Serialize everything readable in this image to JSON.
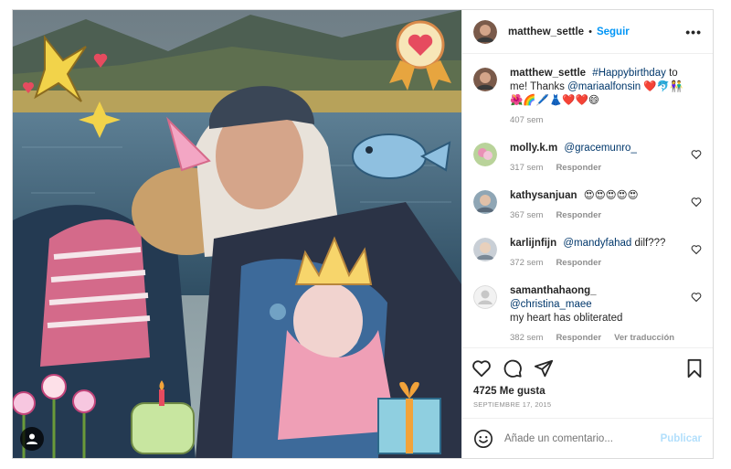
{
  "header": {
    "username": "matthew_settle",
    "separator": "•",
    "follow_label": "Seguir",
    "more_label": "•••"
  },
  "caption": {
    "username": "matthew_settle",
    "hashtag": "#Happybirthday",
    "text_1": "to me! Thanks",
    "mention": "@mariaalfonsin",
    "emojis_1": "❤️🐬👫",
    "emojis_2": "🌺🌈🖊️👗❤️❤️😄",
    "time": "407 sem"
  },
  "comments": [
    {
      "username": "molly.k.m",
      "mention": "@gracemunro_",
      "text": "",
      "time": "317 sem",
      "reply": "Responder",
      "translate": ""
    },
    {
      "username": "kathysanjuan",
      "mention": "",
      "text": "😍😍😍😍😍",
      "time": "367 sem",
      "reply": "Responder",
      "translate": ""
    },
    {
      "username": "karlijnfijn",
      "mention": "@mandyfahad",
      "text": "dilf???",
      "time": "372 sem",
      "reply": "Responder",
      "translate": ""
    },
    {
      "username": "samanthahaong_",
      "mention": "@christina_maee",
      "text": "my heart has obliterated",
      "time": "382 sem",
      "reply": "Responder",
      "translate": "Ver traducción"
    }
  ],
  "likes": "4725 Me gusta",
  "date": "SEPTIEMBRE 17, 2015",
  "add_comment": {
    "placeholder": "Añade un comentario...",
    "publish_label": "Publicar"
  },
  "icons": {
    "like": "heart-icon",
    "comment": "comment-icon",
    "share": "send-icon",
    "save": "bookmark-icon",
    "emoji": "smiley-icon",
    "user_tag": "person-icon",
    "more": "ellipsis-icon"
  },
  "colors": {
    "link": "#0095f6",
    "muted": "#8e8e8e",
    "mention": "#00376b",
    "publish_disabled": "#b2dffc",
    "border": "#dbdbdb"
  }
}
